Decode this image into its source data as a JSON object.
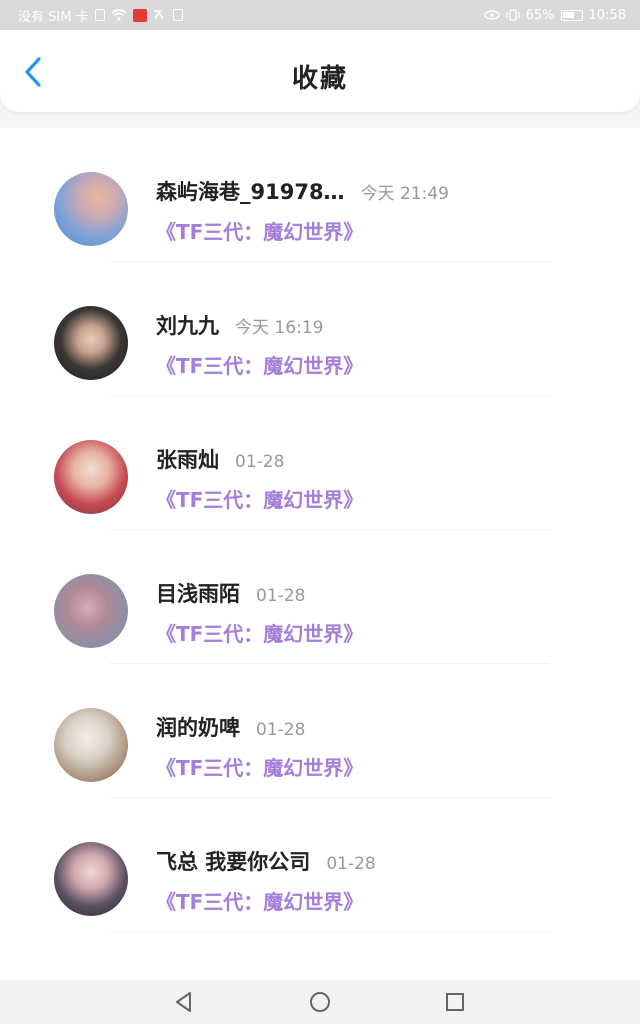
{
  "status_bar": {
    "carrier": "没有 SIM 卡",
    "battery_percent": "65%",
    "time": "10:58"
  },
  "header": {
    "title": "收藏",
    "back_icon": "chevron-left-icon",
    "accent_color": "#2196f3"
  },
  "favorites": [
    {
      "name": "森屿海巷_91978…",
      "time": "今天 21:49",
      "topic": "《TF三代：魔幻世界》"
    },
    {
      "name": "刘九九",
      "time": "今天 16:19",
      "topic": "《TF三代：魔幻世界》"
    },
    {
      "name": "张雨灿",
      "time": "01-28",
      "topic": "《TF三代：魔幻世界》"
    },
    {
      "name": "目浅雨陌",
      "time": "01-28",
      "topic": "《TF三代：魔幻世界》"
    },
    {
      "name": "润的奶啤",
      "time": "01-28",
      "topic": "《TF三代：魔幻世界》"
    },
    {
      "name": "飞总 我要你公司",
      "time": "01-28",
      "topic": "《TF三代：魔幻世界》"
    }
  ],
  "colors": {
    "topic": "#a47ed8",
    "name": "#222222",
    "time": "#999999"
  },
  "nav_bar": {
    "back": "back-triangle-icon",
    "home": "home-circle-icon",
    "recents": "recents-square-icon"
  }
}
